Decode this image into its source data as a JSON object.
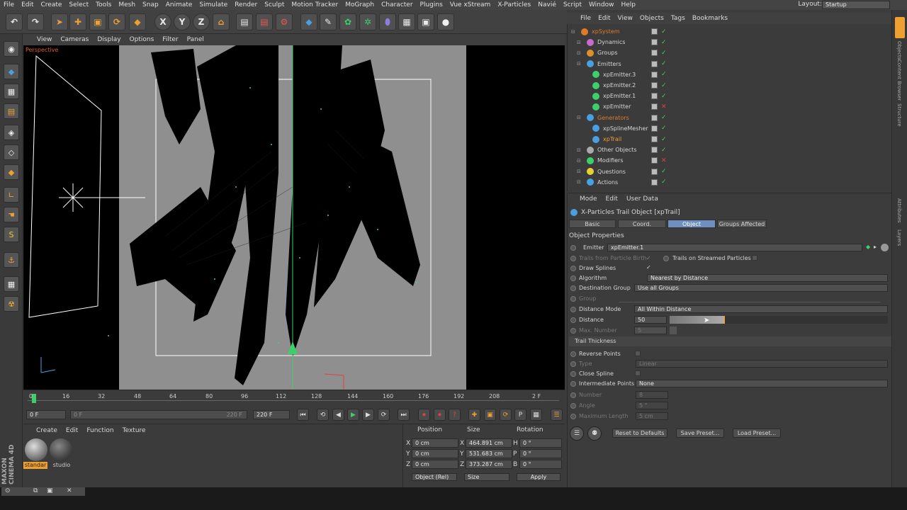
{
  "menu": [
    "File",
    "Edit",
    "Create",
    "Select",
    "Tools",
    "Mesh",
    "Snap",
    "Animate",
    "Simulate",
    "Render",
    "Sculpt",
    "Motion Tracker",
    "MoGraph",
    "Character",
    "Plugins",
    "Vue xStream",
    "X-Particles",
    "Navié",
    "Script",
    "Window",
    "Help"
  ],
  "layout": {
    "label": "Layout:",
    "value": "Startup"
  },
  "toolbar_icons": [
    "undo-icon",
    "move-icon",
    "scale-icon",
    "rotate-icon",
    "model-icon",
    "x-axis-icon",
    "y-axis-icon",
    "z-axis-icon",
    "coord-icon",
    "render-view-icon",
    "render-icon",
    "render-settings-icon",
    "cube-icon",
    "spline-icon",
    "nurbs-icon",
    "array-icon",
    "deformer-icon",
    "scene-icon",
    "camera-icon",
    "light-icon"
  ],
  "axis_labels": {
    "x": "X",
    "y": "Y",
    "z": "Z"
  },
  "viewport": {
    "menu": [
      "View",
      "Cameras",
      "Display",
      "Options",
      "Filter",
      "Panel"
    ],
    "label": "Perspective"
  },
  "timeline": {
    "ticks": [
      "0",
      "16",
      "32",
      "48",
      "64",
      "80",
      "96",
      "112",
      "128",
      "144",
      "160",
      "176",
      "192",
      "208"
    ],
    "current": "2 F",
    "start": "0 F",
    "range_start": "0 F",
    "range_end": "220 F",
    "end": "220 F"
  },
  "materials": {
    "menu": [
      "Create",
      "Edit",
      "Function",
      "Texture"
    ],
    "items": [
      {
        "name": "standar"
      },
      {
        "name": "studio"
      }
    ]
  },
  "coords": {
    "headers": [
      "Position",
      "Size",
      "Rotation"
    ],
    "rows": [
      {
        "axis": "X",
        "pos": "0 cm",
        "size": "464.891 cm",
        "rlabel": "H",
        "rot": "0 °"
      },
      {
        "axis": "Y",
        "pos": "0 cm",
        "size": "531.683 cm",
        "rlabel": "P",
        "rot": "0 °"
      },
      {
        "axis": "Z",
        "pos": "0 cm",
        "size": "373.287 cm",
        "rlabel": "B",
        "rot": "0 °"
      }
    ],
    "mode": "Object (Rel)",
    "size_mode": "Size",
    "apply": "Apply"
  },
  "objects": {
    "menu": [
      "File",
      "Edit",
      "View",
      "Objects",
      "Tags",
      "Bookmarks"
    ],
    "items": [
      {
        "name": "xpSystem",
        "color": "#e07a2a",
        "ico": "#e07a2a",
        "indent": 0,
        "ok": true
      },
      {
        "name": "Dynamics",
        "color": "#d6d6d6",
        "ico": "#c86bd0",
        "indent": 1,
        "ok": true
      },
      {
        "name": "Groups",
        "color": "#d6d6d6",
        "ico": "#e0902a",
        "indent": 1,
        "ok": true
      },
      {
        "name": "Emitters",
        "color": "#d6d6d6",
        "ico": "#4a9fe0",
        "indent": 1,
        "ok": true
      },
      {
        "name": "xpEmitter.3",
        "color": "#d6d6d6",
        "ico": "#3cd06a",
        "indent": 2,
        "ok": true
      },
      {
        "name": "xpEmitter.2",
        "color": "#d6d6d6",
        "ico": "#3cd06a",
        "indent": 2,
        "ok": true
      },
      {
        "name": "xpEmitter.1",
        "color": "#d6d6d6",
        "ico": "#3cd06a",
        "indent": 2,
        "ok": true
      },
      {
        "name": "xpEmitter",
        "color": "#d6d6d6",
        "ico": "#3cd06a",
        "indent": 2,
        "ok": false
      },
      {
        "name": "Generators",
        "color": "#e07a2a",
        "ico": "#4a9fe0",
        "indent": 1,
        "ok": true
      },
      {
        "name": "xpSplineMesher",
        "color": "#d6d6d6",
        "ico": "#4a9fe0",
        "indent": 2,
        "ok": true
      },
      {
        "name": "xpTrail",
        "color": "#f0a030",
        "ico": "#4a9fe0",
        "indent": 2,
        "ok": true
      },
      {
        "name": "Other Objects",
        "color": "#d6d6d6",
        "ico": "#aaaaaa",
        "indent": 1,
        "ok": true
      },
      {
        "name": "Modifiers",
        "color": "#d6d6d6",
        "ico": "#3cd06a",
        "indent": 1,
        "ok": false
      },
      {
        "name": "Questions",
        "color": "#d6d6d6",
        "ico": "#e8d030",
        "indent": 1,
        "ok": true
      },
      {
        "name": "Actions",
        "color": "#d6d6d6",
        "ico": "#4a9fe0",
        "indent": 1,
        "ok": true
      }
    ]
  },
  "attributes": {
    "menu": [
      "Mode",
      "Edit",
      "User Data"
    ],
    "title": "X-Particles Trail Object [xpTrail]",
    "tabs": [
      "Basic",
      "Coord.",
      "Object",
      "Groups Affected"
    ],
    "section": "Object Properties",
    "emitter_label": "Emitter",
    "emitter_value": "xpEmitter.1",
    "trails_from_birth": "Trails from Particle Birth",
    "trails_streamed": "Trails on Streamed Particles",
    "draw_splines": "Draw Splines",
    "algorithm_label": "Algorithm",
    "algorithm_value": "Nearest by Distance",
    "dest_group_label": "Destination Group",
    "dest_group_value": "Use all Groups",
    "group_label": "Group",
    "distance_mode_label": "Distance Mode",
    "distance_mode_value": "All Within Distance",
    "distance_label": "Distance",
    "distance_value": "50",
    "max_number_label": "Max. Number",
    "max_number_value": "5",
    "trail_thickness": "Trail Thickness",
    "reverse_points": "Reverse Points",
    "type_label": "Type",
    "type_value": "Linear",
    "close_spline": "Close Spline",
    "intermediate_label": "Intermediate Points",
    "intermediate_value": "None",
    "number_label": "Number",
    "number_value": "8",
    "angle_label": "Angle",
    "angle_value": "5 °",
    "max_length_label": "Maximum Length",
    "max_length_value": "5 cm",
    "reset": "Reset to Defaults",
    "save": "Save Preset...",
    "load": "Load Preset..."
  },
  "side_tabs": [
    "Objects",
    "Content Browser",
    "Structure"
  ],
  "side_tabs_lower": [
    "Attributes",
    "Layers"
  ],
  "logo": "MAXON CINEMA 4D"
}
